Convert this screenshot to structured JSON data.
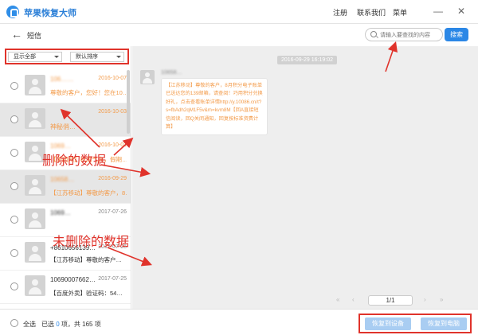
{
  "app": {
    "title": "苹果恢复大师"
  },
  "titlebar": {
    "register": "注册",
    "contact": "联系我们",
    "menu": "菜单",
    "minimize": "—",
    "close": "✕"
  },
  "nav": {
    "back": "←",
    "title": "短信",
    "search_placeholder": "请输入要查找的内容",
    "search_button": "搜索"
  },
  "filters": {
    "show": "显示全部",
    "sort": "默认排序"
  },
  "messages": [
    {
      "name": "106……",
      "date": "2016-10-07",
      "preview": "尊敬的客户，您好！您在10…",
      "deleted": true
    },
    {
      "name": "神秘俏…",
      "date": "2016-10-03",
      "preview": "",
      "deleted": true
    },
    {
      "name": "1069…",
      "date": "2016-10-01",
      "preview": "【美团网】秋高气爽，假期…",
      "deleted": true
    },
    {
      "name": "10658…",
      "date": "2016-09-29",
      "preview": "【江苏移动】尊敬的客户，8…",
      "deleted": true
    },
    {
      "name": "1069…",
      "date": "2017-07-26",
      "preview": "",
      "deleted": false
    },
    {
      "name": "+8610656139…",
      "date": "2017-07-26",
      "preview": "【江苏移动】尊敬的客户…",
      "deleted": false
    },
    {
      "name": "10690007662…",
      "date": "2017-07-25",
      "preview": "【百度外卖】验证码：54…",
      "deleted": false
    }
  ],
  "annotations": {
    "deleted": "删除的数据",
    "not_deleted": "未删除的数据"
  },
  "chat": {
    "time": "2016-09-29 16:19:02",
    "sender": "10658…",
    "message": "【江苏移动】尊敬的客户，8月积分电子账单已送达您的139邮箱，请查阅！巧用积分兑换好礼，点击查看账单详情http://y.10086.cn/t?s=fbAdh2qM1F5v&m=kvm8M【回A直接短信阅读，回Q关闭通知，回复按标准资费计算】"
  },
  "pager": {
    "first": "«",
    "prev": "‹",
    "page": "1/1",
    "next": "›",
    "last": "»"
  },
  "bottom": {
    "select_all": "全选",
    "selected_prefix": "已选",
    "selected_count": "0",
    "selected_mid": "项，共",
    "total_count": "165",
    "selected_suffix": "项",
    "restore_device": "恢复到设备",
    "restore_pc": "恢复到电脑"
  },
  "colors": {
    "accent": "#2b87e6",
    "deleted_text": "#f39b4a",
    "annotation_red": "#e0332b"
  }
}
